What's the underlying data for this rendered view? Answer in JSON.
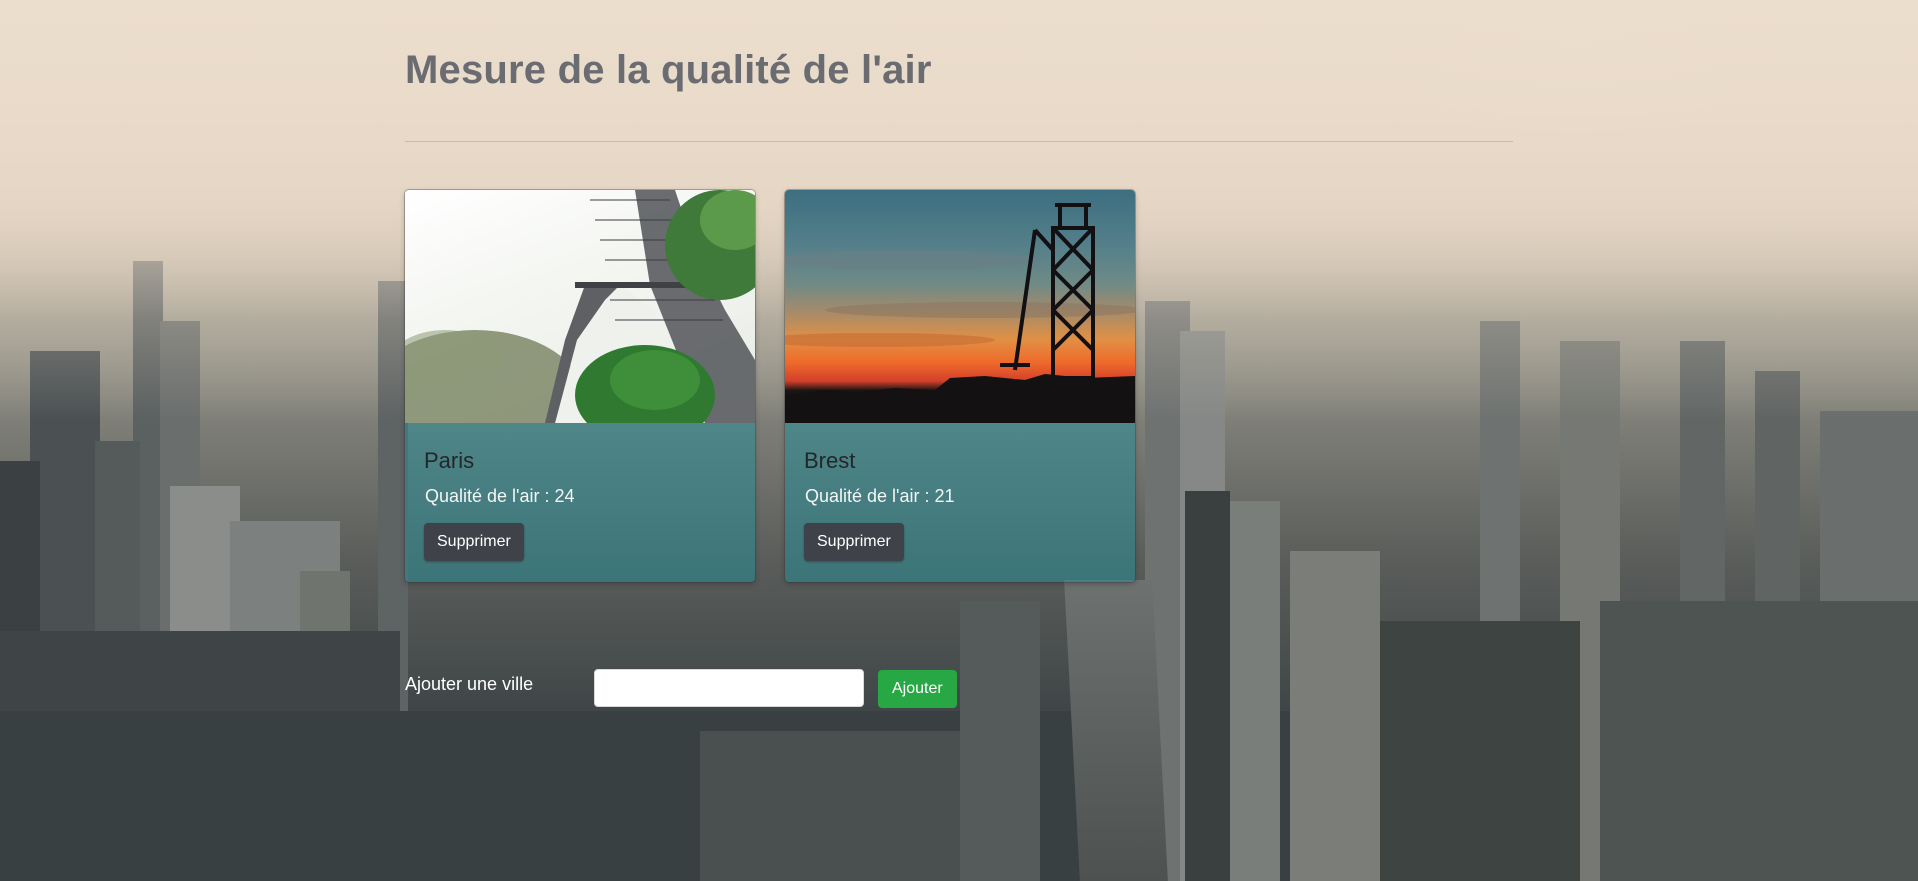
{
  "page": {
    "title": "Mesure de la qualité de l'air"
  },
  "cities": [
    {
      "name": "Paris",
      "air_quality_label": "Qualité de l'air : 24",
      "delete_label": "Supprimer",
      "image": "eiffel-tower-photo"
    },
    {
      "name": "Brest",
      "air_quality_label": "Qualité de l'air : 21",
      "delete_label": "Supprimer",
      "image": "sunset-crane-photo"
    }
  ],
  "add_city": {
    "label": "Ajouter une ville",
    "input_value": "",
    "placeholder": "",
    "button_label": "Ajouter"
  },
  "colors": {
    "add_button": "#28a745",
    "delete_button": "#3f4249",
    "card_body": "#288c96",
    "title": "#6a6c72"
  }
}
